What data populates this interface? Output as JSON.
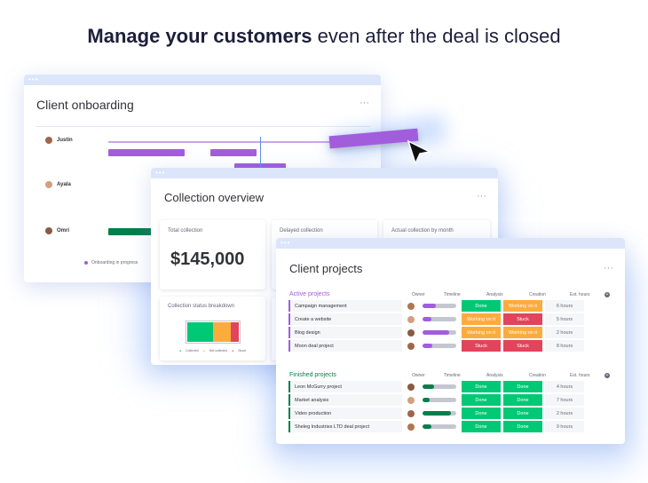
{
  "headline": {
    "bold": "Manage your customers",
    "rest": " even after the deal is closed"
  },
  "onboarding": {
    "title": "Client onboarding",
    "more": "···",
    "people": [
      "Justin",
      "Ayala",
      "Omri"
    ],
    "legend": "Onboarding in progress"
  },
  "collection": {
    "title": "Collection overview",
    "more": "···",
    "total_label": "Total collection",
    "total_value": "$145,000",
    "delayed_label": "Delayed collection",
    "actual_label": "Actual collection by month",
    "status_label": "Collection status breakdown",
    "legend": [
      "Collected",
      "Not collected",
      "Stuck"
    ]
  },
  "projects": {
    "title": "Client projects",
    "more": "···",
    "columns": [
      "Owner",
      "Timeline",
      "Analysis",
      "Creation",
      "Est. hours"
    ],
    "active_label": "Active projects",
    "finished_label": "Finished projects",
    "active": [
      {
        "name": "Campaign management",
        "analysis": "Done",
        "creation": "Working on it",
        "hours": "6 hours"
      },
      {
        "name": "Create a website",
        "analysis": "Working on it",
        "creation": "Stuck",
        "hours": "5 hours"
      },
      {
        "name": "Blog design",
        "analysis": "Working on it",
        "creation": "Working on it",
        "hours": "2 hours"
      },
      {
        "name": "Moon deal project",
        "analysis": "Stuck",
        "creation": "Stuck",
        "hours": "8 hours"
      }
    ],
    "finished": [
      {
        "name": "Leon McGurry project",
        "analysis": "Done",
        "creation": "Done",
        "hours": "4 hours"
      },
      {
        "name": "Market analysis",
        "analysis": "Done",
        "creation": "Done",
        "hours": "7 hours"
      },
      {
        "name": "Video production",
        "analysis": "Done",
        "creation": "Done",
        "hours": "2 hours"
      },
      {
        "name": "Sheleg Industries LTD deal project",
        "analysis": "Done",
        "creation": "Done",
        "hours": "9 hours"
      }
    ]
  },
  "colors": {
    "done": "#00c875",
    "working": "#fdab3d",
    "stuck": "#e2445c",
    "purple": "#a25ddc",
    "green": "#037f4c"
  }
}
